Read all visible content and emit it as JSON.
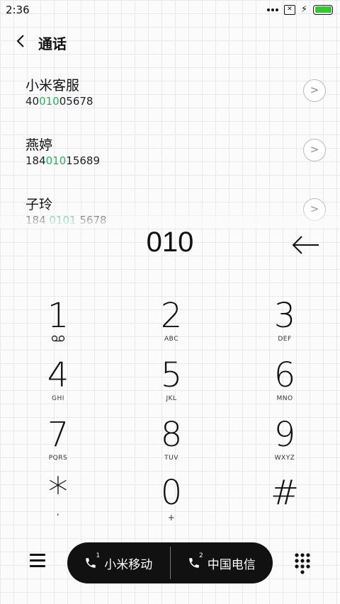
{
  "status": {
    "time": "2:36"
  },
  "header": {
    "title": "通话"
  },
  "contacts": [
    {
      "name": "小米客服",
      "number_pre": "40",
      "number_match": "010",
      "number_post": "05678"
    },
    {
      "name": "燕婷",
      "number_pre": "184",
      "number_match": "010",
      "number_post": "15689"
    },
    {
      "name": "子玲",
      "number_pre": "184 ",
      "number_match": "0101",
      "number_post": " 5678"
    }
  ],
  "dial": {
    "entered": "010"
  },
  "keys": [
    {
      "digit": "1",
      "letters": ""
    },
    {
      "digit": "2",
      "letters": "ABC"
    },
    {
      "digit": "3",
      "letters": "DEF"
    },
    {
      "digit": "4",
      "letters": "GHI"
    },
    {
      "digit": "5",
      "letters": "JKL"
    },
    {
      "digit": "6",
      "letters": "MNO"
    },
    {
      "digit": "7",
      "letters": "PQRS"
    },
    {
      "digit": "8",
      "letters": "TUV"
    },
    {
      "digit": "9",
      "letters": "WXYZ"
    },
    {
      "digit": "*",
      "letters": ","
    },
    {
      "digit": "0",
      "letters": "+"
    },
    {
      "digit": "#",
      "letters": ""
    }
  ],
  "calls": {
    "sim1": {
      "label": "小米移动",
      "slot": "1"
    },
    "sim2": {
      "label": "中国电信",
      "slot": "2"
    }
  },
  "colors": {
    "highlight": "#22b35a",
    "battery": "#2ecc2e",
    "pill": "#111111"
  }
}
